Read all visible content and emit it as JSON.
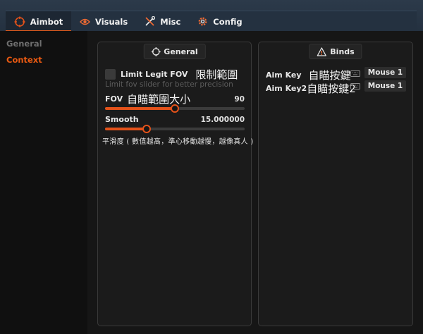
{
  "tabs": [
    {
      "label": "Aimbot",
      "icon": "crosshair-icon",
      "active": true
    },
    {
      "label": "Visuals",
      "icon": "eye-icon",
      "active": false
    },
    {
      "label": "Misc",
      "icon": "tools-icon",
      "active": false
    },
    {
      "label": "Config",
      "icon": "gear-icon",
      "active": false
    }
  ],
  "sidebar": {
    "items": [
      {
        "label": "General",
        "active": false
      },
      {
        "label": "Context",
        "active": true
      }
    ]
  },
  "general_panel": {
    "title": "General",
    "limit_fov": {
      "label": "Limit Legit FOV",
      "cjk": "限制範圍",
      "checked": false
    },
    "hint": "Limit fov slider for better precision",
    "fov": {
      "label": "FOV",
      "cjk": "自瞄範圍大小",
      "value": "90",
      "fraction": 0.5
    },
    "smooth": {
      "label": "Smooth",
      "value": "15.000000",
      "fraction": 0.3,
      "cjk_note": "平滑度 ( 數值越高，準心移動越慢，越像真人 )"
    }
  },
  "binds_panel": {
    "title": "Binds",
    "binds": [
      {
        "label": "Aim Key",
        "cjk": "自瞄按鍵",
        "key": "Mouse 1"
      },
      {
        "label": "Aim Key2",
        "cjk": "自瞄按鍵2",
        "key": "Mouse 1"
      }
    ]
  },
  "colors": {
    "accent": "#e3521a",
    "tab_bar": "#243140",
    "panel_bg": "#1b1b1b"
  }
}
